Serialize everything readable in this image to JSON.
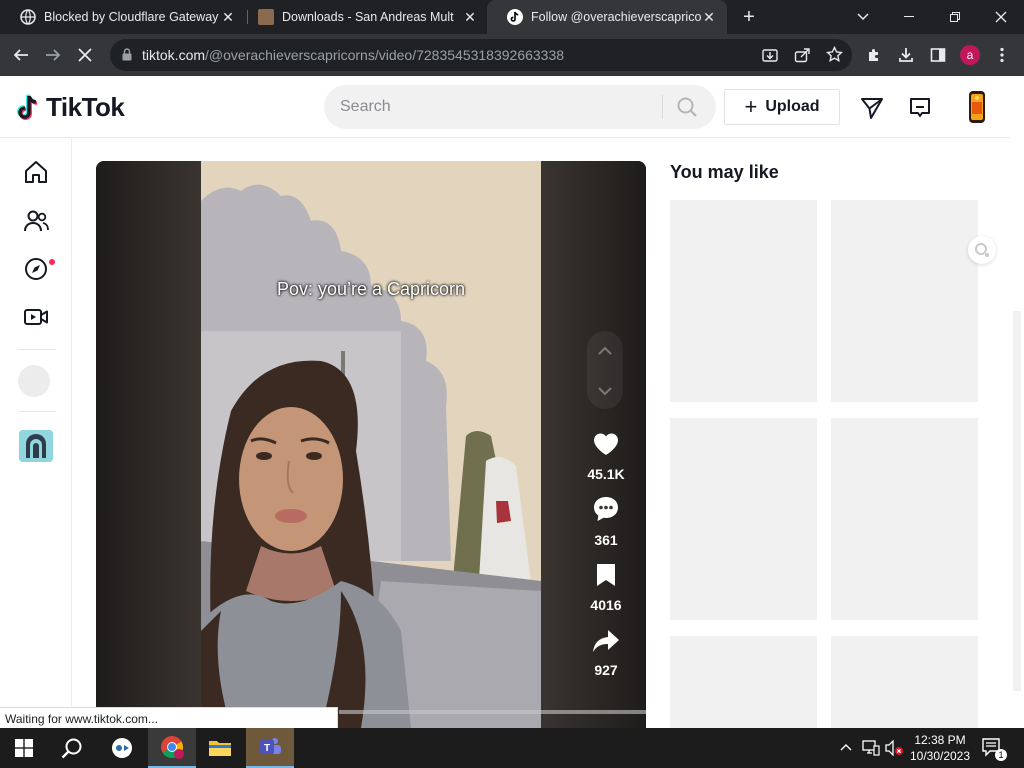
{
  "browser": {
    "tabs": [
      {
        "title": "Blocked by Cloudflare Gateway",
        "active": false
      },
      {
        "title": "Downloads - San Andreas Multip",
        "active": false
      },
      {
        "title": "Follow @overachieverscapricorn",
        "active": true
      }
    ],
    "url_host": "tiktok.com",
    "url_path": "/@overachieverscapricorns/video/7283545318392663338",
    "profile_initial": "a",
    "status_text": "Waiting for www.tiktok.com..."
  },
  "tiktok": {
    "logo_text": "TikTok",
    "search_placeholder": "Search",
    "upload_label": "Upload",
    "video": {
      "caption": "Pov: you’re a Capricorn",
      "likes": "45.1K",
      "comments": "361",
      "saves": "4016",
      "shares": "927"
    },
    "you_may_like_title": "You may like"
  },
  "taskbar": {
    "time": "12:38 PM",
    "date": "10/30/2023",
    "notification_count": "1"
  },
  "colors": {
    "tiktok_red": "#fe2c55",
    "tiktok_cyan": "#25f4ee",
    "chrome_dark": "#202124"
  }
}
